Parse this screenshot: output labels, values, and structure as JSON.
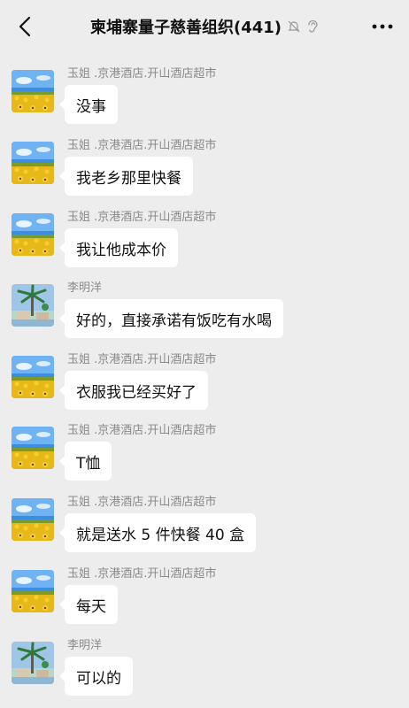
{
  "header": {
    "title": "柬埔寨量子慈善组织(441)",
    "icons": [
      "back-arrow",
      "mute-bell",
      "ear",
      "more-dots"
    ]
  },
  "colors": {
    "background": "#ededed",
    "bubble": "#ffffff",
    "sender_text": "#8a8a8a"
  },
  "messages": [
    {
      "sender": "玉姐 .京港酒店.开山酒店超市",
      "avatar": "sunflower-field",
      "text": "没事"
    },
    {
      "sender": "玉姐 .京港酒店.开山酒店超市",
      "avatar": "sunflower-field",
      "text": "我老乡那里快餐"
    },
    {
      "sender": "玉姐 .京港酒店.开山酒店超市",
      "avatar": "sunflower-field",
      "text": "我让他成本价"
    },
    {
      "sender": "李明洋",
      "avatar": "palm-resort",
      "text": "好的，直接承诺有饭吃有水喝"
    },
    {
      "sender": "玉姐 .京港酒店.开山酒店超市",
      "avatar": "sunflower-field",
      "text": "衣服我已经买好了"
    },
    {
      "sender": "玉姐 .京港酒店.开山酒店超市",
      "avatar": "sunflower-field",
      "text": "T恤"
    },
    {
      "sender": "玉姐 .京港酒店.开山酒店超市",
      "avatar": "sunflower-field",
      "text": "就是送水 5 件快餐 40 盒"
    },
    {
      "sender": "玉姐 .京港酒店.开山酒店超市",
      "avatar": "sunflower-field",
      "text": "每天"
    },
    {
      "sender": "李明洋",
      "avatar": "palm-resort",
      "text": "可以的"
    }
  ]
}
